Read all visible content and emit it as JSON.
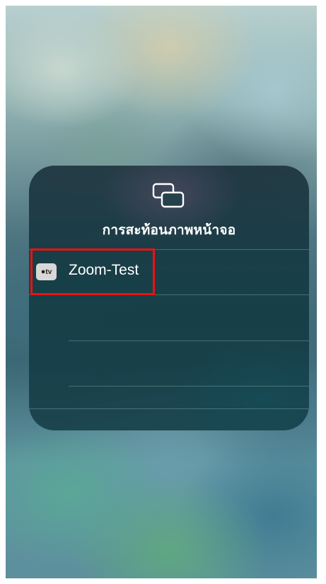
{
  "panel": {
    "icon": "screen-mirroring-icon",
    "title": "การสะท้อนภาพหน้าจอ",
    "devices": [
      {
        "icon": "apple-tv-icon",
        "badge_text": "tv",
        "name": "Zoom-Test"
      }
    ]
  },
  "highlight": {
    "color": "#ee1111"
  }
}
